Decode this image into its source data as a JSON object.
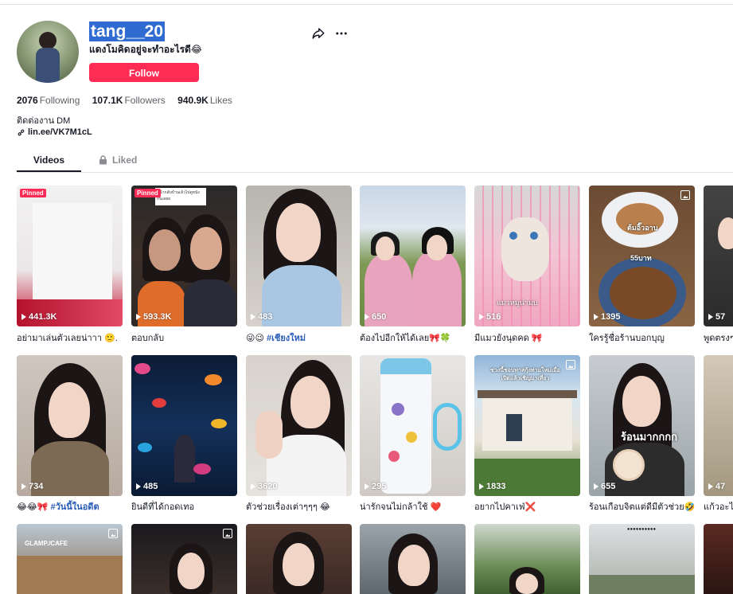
{
  "profile": {
    "username": "tang__20",
    "nickname": "แดงโมคิดอยู่จะทำอะไรดี😂",
    "follow_label": "Follow",
    "stats": [
      {
        "value": "2076",
        "label": "Following"
      },
      {
        "value": "107.1K",
        "label": "Followers"
      },
      {
        "value": "940.9K",
        "label": "Likes"
      }
    ],
    "bio": "ติดต่องาน DM",
    "link": "lin.ee/VK7M1cL"
  },
  "tabs": {
    "videos": "Videos",
    "liked": "Liked"
  },
  "videos": [
    {
      "views": "441.3K",
      "caption": "อย่ามาเล่นตัวเลยน่าาา 🙂.",
      "badge": "Pinned"
    },
    {
      "views": "593.3K",
      "caption": "ตอบกลับ",
      "badge": "Pinned"
    },
    {
      "views": "483",
      "caption": "😜😉",
      "tag": "#เชียงใหม่"
    },
    {
      "views": "650",
      "caption": "ต้องไปอีกให้ได้เลย🎀🍀"
    },
    {
      "views": "516",
      "caption": "มีแมวยังนุดคด 🎀"
    },
    {
      "views": "1395",
      "caption": "ใครรู้ชื่อร้านบอกบุญ"
    },
    {
      "views": "57",
      "caption": "พูดตรงๆ"
    },
    {
      "views": "734",
      "caption": "😂😂🎀",
      "tag": "#วันนี้ในอดีต"
    },
    {
      "views": "485",
      "caption": "ยินดีที่ได้กอดเทอ"
    },
    {
      "views": "3620",
      "caption": "ตัวช่วยเรื่องเต่าๆๆๆ 😂"
    },
    {
      "views": "295",
      "caption": "น่ารักจนไม่กล้าใช้ ❤️"
    },
    {
      "views": "1833",
      "caption": "อยากไปคาเฟ่❌"
    },
    {
      "views": "655",
      "caption": "ร้อนเกือบจิตแต่ดีมีตัวช่วย🤣"
    },
    {
      "views": "47",
      "caption": "แก้วอะไ"
    }
  ],
  "overlay_text": {
    "card2_top": "หน้ากลับบ้านเล้วไปดูหนังกันเลยย",
    "card6_top": "ต้มอิ๊วอาบ",
    "card6_price": "55บาท",
    "card5_bottom": "แมวหมูน่ามบ",
    "card12_top": "ช่วงนี้ชอบทาสกุ้งท่ามใหม่เมื่อ",
    "card12_sub": "เปิดแล้วเชิญมาเที่ยว",
    "card13_top": "ร้อนมากกกก",
    "card15_top": "GLAMP./CAFE"
  },
  "colors": {
    "accent": "#fe2c55",
    "link_blue": "#2b5db9",
    "username_highlight": "#2f6bd1"
  }
}
